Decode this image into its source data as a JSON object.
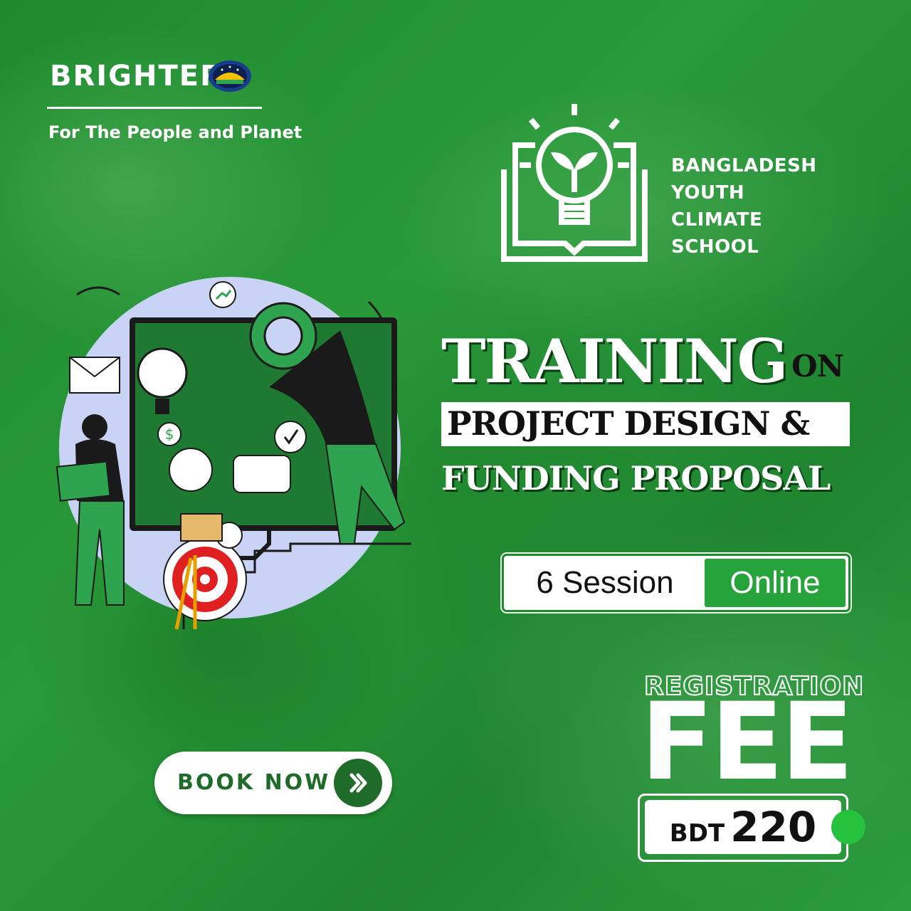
{
  "brand": {
    "name": "BRIGHTERS",
    "tagline": "For The People and Planet"
  },
  "school": {
    "lines": [
      "BANGLADESH",
      "YOUTH",
      "CLIMATE",
      "SCHOOL"
    ]
  },
  "headline": {
    "word1": "TRAINING",
    "word2": "ON",
    "line2": "PROJECT DESIGN &",
    "line3": "FUNDING PROPOSAL"
  },
  "session": {
    "count_label": "6 Session",
    "mode_label": "Online"
  },
  "fee": {
    "registration_label": "REGISTRATION",
    "fee_label": "FEE",
    "currency": "BDT",
    "amount": "220"
  },
  "cta": {
    "label": "BOOK NOW",
    "icon": "double-chevron-right-icon"
  },
  "colors": {
    "background": "#1d8a2e",
    "accent_dark": "#1f6b2a",
    "accent_bright": "#26c23e",
    "text_light": "#ffffff",
    "text_dark": "#111111"
  }
}
